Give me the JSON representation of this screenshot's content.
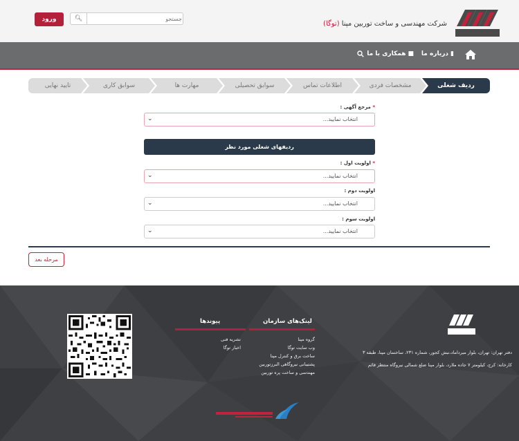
{
  "header": {
    "company_name_prefix": "شرکت مهندسی و ساخت توربین مپنا",
    "company_name_accent": "(توگا)",
    "search_placeholder": "جستجو",
    "login_label": "ورود"
  },
  "nav": {
    "items": [
      {
        "label": "درباره ما"
      },
      {
        "label": "همکاری با ما"
      }
    ]
  },
  "steps": [
    {
      "label": "ردیف شغلی",
      "active": true
    },
    {
      "label": "مشخصات فردی"
    },
    {
      "label": "اطلاعات تماس"
    },
    {
      "label": "سوابق تحصیلی"
    },
    {
      "label": "مهارت ها"
    },
    {
      "label": "سوابق کاری"
    },
    {
      "label": "تایید نهایی"
    }
  ],
  "form": {
    "ad_source": {
      "label": "مرجع آگهی :",
      "value": "انتخاب نمایید..."
    },
    "section_title": "ردیفهای شغلی مورد نظر",
    "priority1": {
      "label": "اولویت اول :",
      "value": "انتخاب نمایید..."
    },
    "priority2": {
      "label": "اولویت دوم :",
      "value": "انتخاب نمایید..."
    },
    "priority3": {
      "label": "اولویت سوم :",
      "value": "انتخاب نمایید..."
    },
    "next_label": "مرحله بعد"
  },
  "footer": {
    "address_office": "دفتر تهران: تهران، بلوار میرداماد،نبش کجور، شماره ۲۳۱، ساختمان مپنا، طبقه ۳",
    "address_factory": "کارخانه: کرج، کیلومتر ۷ جاده ملارد، بلوار مپنا ضلع شمالی نیروگاه منتظر قائم",
    "org_links_title": "لینک‌های سازمان",
    "org_links": [
      "گروه مپنا",
      "وب سایت توگا",
      "ساخت برق و کنترل مپنا",
      "پشتیبانی نیروگاهی البرزتوربین",
      "مهندسی و ساخت پره توربین"
    ],
    "links_title": "پیوندها",
    "links": [
      "نشریه فنی",
      "اخبار توگا"
    ]
  },
  "colors": {
    "accent": "#b3203a",
    "navy": "#2b3a4a",
    "nav": "#6b6c6e",
    "footer": "#3f4044"
  }
}
